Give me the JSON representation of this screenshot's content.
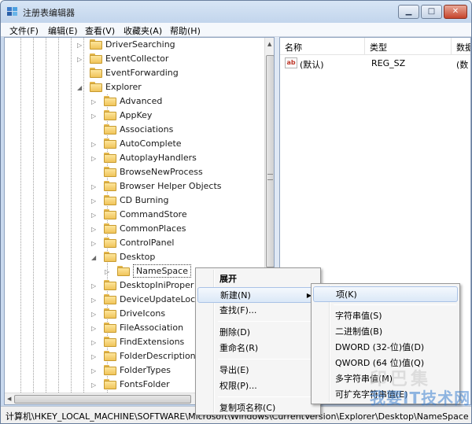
{
  "window": {
    "title": "注册表编辑器"
  },
  "menubar": [
    "文件(F)",
    "编辑(E)",
    "查看(V)",
    "收藏夹(A)",
    "帮助(H)"
  ],
  "tree": {
    "items": [
      {
        "label": "DriverSearching",
        "indent": 1,
        "expander": "collapsed"
      },
      {
        "label": "EventCollector",
        "indent": 1,
        "expander": "collapsed"
      },
      {
        "label": "EventForwarding",
        "indent": 1,
        "expander": "none"
      },
      {
        "label": "Explorer",
        "indent": 1,
        "expander": "expanded"
      },
      {
        "label": "Advanced",
        "indent": 2,
        "expander": "collapsed"
      },
      {
        "label": "AppKey",
        "indent": 2,
        "expander": "collapsed"
      },
      {
        "label": "Associations",
        "indent": 2,
        "expander": "none"
      },
      {
        "label": "AutoComplete",
        "indent": 2,
        "expander": "collapsed"
      },
      {
        "label": "AutoplayHandlers",
        "indent": 2,
        "expander": "collapsed"
      },
      {
        "label": "BrowseNewProcess",
        "indent": 2,
        "expander": "none"
      },
      {
        "label": "Browser Helper Objects",
        "indent": 2,
        "expander": "collapsed"
      },
      {
        "label": "CD Burning",
        "indent": 2,
        "expander": "collapsed"
      },
      {
        "label": "CommandStore",
        "indent": 2,
        "expander": "collapsed"
      },
      {
        "label": "CommonPlaces",
        "indent": 2,
        "expander": "collapsed"
      },
      {
        "label": "ControlPanel",
        "indent": 2,
        "expander": "collapsed"
      },
      {
        "label": "Desktop",
        "indent": 2,
        "expander": "expanded"
      },
      {
        "label": "NameSpace",
        "indent": 3,
        "expander": "collapsed",
        "selected": true
      },
      {
        "label": "DesktopIniProper",
        "indent": 2,
        "expander": "collapsed"
      },
      {
        "label": "DeviceUpdateLoc",
        "indent": 2,
        "expander": "collapsed"
      },
      {
        "label": "DriveIcons",
        "indent": 2,
        "expander": "collapsed"
      },
      {
        "label": "FileAssociation",
        "indent": 2,
        "expander": "collapsed"
      },
      {
        "label": "FindExtensions",
        "indent": 2,
        "expander": "collapsed"
      },
      {
        "label": "FolderDescription",
        "indent": 2,
        "expander": "collapsed"
      },
      {
        "label": "FolderTypes",
        "indent": 2,
        "expander": "collapsed"
      },
      {
        "label": "FontsFolder",
        "indent": 2,
        "expander": "collapsed"
      }
    ]
  },
  "list": {
    "columns": [
      "名称",
      "类型",
      "数据"
    ],
    "rows": [
      {
        "name": "(默认)",
        "type": "REG_SZ",
        "data": "(数"
      }
    ]
  },
  "context_menu": {
    "items": [
      {
        "label": "展开",
        "bold": true
      },
      {
        "label": "新建(N)",
        "submenu": true,
        "highlighted": true
      },
      {
        "label": "查找(F)..."
      },
      {
        "separator": true
      },
      {
        "label": "删除(D)"
      },
      {
        "label": "重命名(R)"
      },
      {
        "separator": true
      },
      {
        "label": "导出(E)"
      },
      {
        "label": "权限(P)..."
      },
      {
        "separator": true
      },
      {
        "label": "复制项名称(C)"
      }
    ]
  },
  "submenu": {
    "items": [
      {
        "label": "项(K)",
        "highlighted": true
      },
      {
        "separator": true
      },
      {
        "label": "字符串值(S)"
      },
      {
        "label": "二进制值(B)"
      },
      {
        "label": "DWORD (32-位)值(D)"
      },
      {
        "label": "QWORD (64 位)值(Q)"
      },
      {
        "label": "多字符串值(M)"
      },
      {
        "label": "可扩充字符串值(E)"
      }
    ]
  },
  "status": {
    "path": "计算机\\HKEY_LOCAL_MACHINE\\SOFTWARE\\Microsoft\\Windows\\CurrentVersion\\Explorer\\Desktop\\NameSpace"
  },
  "watermark": {
    "line1": "印巴集",
    "line2": "我要IT技术网"
  },
  "colors": {
    "selection_border": "#a9c2e6",
    "folder": "#f0c45a",
    "title_bar": "#c9d9ee"
  }
}
